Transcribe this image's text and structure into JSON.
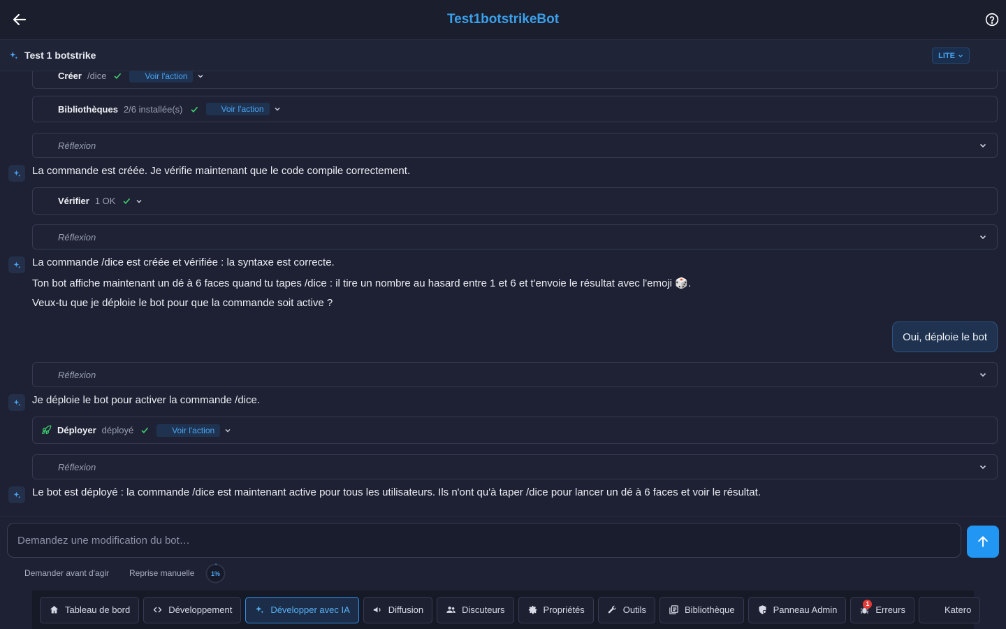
{
  "header": {
    "title": "Test1botstrikeBot"
  },
  "project": {
    "name": "Test 1 botstrike",
    "plan_badge": "LITE"
  },
  "chat": {
    "step_create": {
      "label": "Créer",
      "meta": "/dice",
      "action": "Voir l'action"
    },
    "step_libs": {
      "label": "Bibliothèques",
      "meta": "2/6 installée(s)",
      "action": "Voir l'action"
    },
    "reflection_label": "Réflexion",
    "ai_msg_1": "La commande est créée. Je vérifie maintenant que le code compile correctement.",
    "step_verify": {
      "label": "Vérifier",
      "meta": "1 OK"
    },
    "ai_msg_2": [
      "La commande /dice est créée et vérifiée : la syntaxe est correcte.",
      "Ton bot affiche maintenant un dé à 6 faces quand tu tapes /dice : il tire un nombre au hasard entre 1 et 6 et t'envoie le résultat avec l'emoji 🎲.",
      "Veux-tu que je déploie le bot pour que la commande soit active ?"
    ],
    "user_msg": "Oui, déploie le bot",
    "ai_msg_3": "Je déploie le bot pour activer la commande /dice.",
    "step_deploy": {
      "label": "Déployer",
      "meta": "déployé",
      "action": "Voir l'action"
    },
    "ai_msg_4": "Le bot est déployé : la commande /dice est maintenant active pour tous les utilisateurs. Ils n'ont qu'à taper /dice pour lancer un dé à 6 faces et voir le résultat."
  },
  "composer": {
    "placeholder": "Demandez une modification du bot…",
    "ask_before": "Demander avant d'agir",
    "manual_resume": "Reprise manuelle",
    "usage_percent": "1%",
    "usage_fraction": 0.01
  },
  "nav": {
    "dashboard": "Tableau de bord",
    "development": "Développement",
    "ai_dev": "Développer avec IA",
    "broadcast": "Diffusion",
    "chatters": "Discuteurs",
    "properties": "Propriétés",
    "tools": "Outils",
    "library": "Bibliothèque",
    "admin": "Panneau Admin",
    "errors": "Erreurs",
    "errors_count": "1",
    "user": "Katero"
  },
  "colors": {
    "accent": "#2196f3",
    "success": "#3ecf6e",
    "background": "#1d2133"
  }
}
